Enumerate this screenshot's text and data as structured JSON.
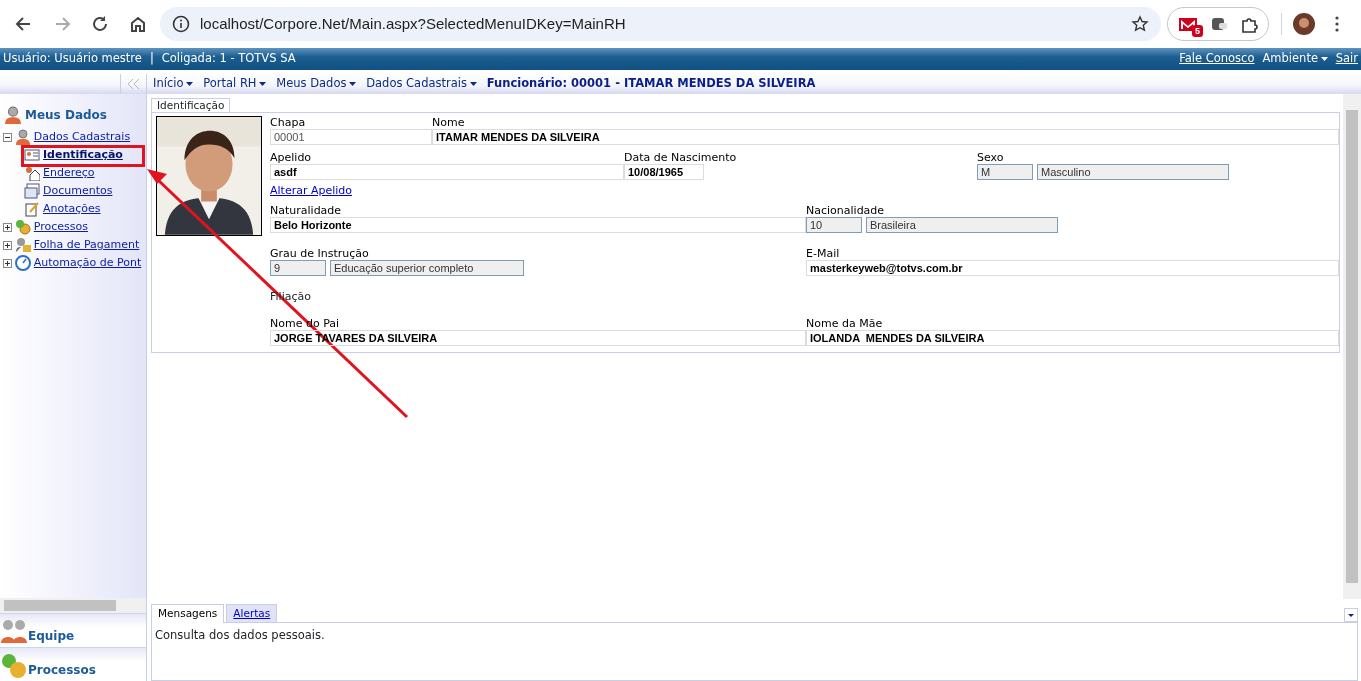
{
  "browser": {
    "url": "localhost/Corpore.Net/Main.aspx?SelectedMenuIDKey=MainRH",
    "extension_badge": "5"
  },
  "topbar": {
    "user": "Usuário: Usuário mestre",
    "separator": "|",
    "company": "Coligada: 1 - TOTVS SA",
    "links": [
      {
        "label": "Fale Conosco",
        "kind": "link"
      },
      {
        "label": "Ambiente",
        "kind": "menu"
      },
      {
        "label": "Sair",
        "kind": "link"
      }
    ]
  },
  "breadcrumb": {
    "items": [
      "Início",
      "Portal RH",
      "Meus Dados",
      "Dados Cadastrais"
    ],
    "current": "Funcionário: 00001 - ITAMAR MENDES DA SILVEIRA"
  },
  "sidebar": {
    "title": "Meus Dados",
    "tree": [
      {
        "label": "Dados Cadastrais",
        "expanded": true,
        "children": [
          {
            "label": "Identificação",
            "selected": true
          },
          {
            "label": "Endereço",
            "selected": false
          },
          {
            "label": "Documentos",
            "selected": false
          },
          {
            "label": "Anotações",
            "selected": false
          }
        ]
      },
      {
        "label": "Processos",
        "expanded": false
      },
      {
        "label": "Folha de Pagament",
        "expanded": false
      },
      {
        "label": "Automação de Pont",
        "expanded": false
      }
    ],
    "sections": [
      "Equipe",
      "Processos"
    ]
  },
  "content": {
    "tabs": [
      {
        "label": "Identificação",
        "selected": true
      }
    ],
    "form": [
      {
        "kind": "fields",
        "fields": [
          {
            "label": "Chapa",
            "kind": "muted",
            "value": "00001"
          },
          {
            "label": "Nome",
            "kind": "text",
            "value": "ITAMAR MENDES DA SILVEIRA"
          }
        ]
      },
      {
        "kind": "fields",
        "fields": [
          {
            "label": "Apelido",
            "kind": "text",
            "value": "asdf"
          },
          {
            "label": "Data de Nascimento",
            "kind": "text",
            "value": "10/08/1965"
          },
          {
            "label": "Sexo",
            "kind": "lookup",
            "code": "M",
            "value": "Masculino"
          }
        ]
      },
      {
        "kind": "link",
        "label": "Alterar Apelido"
      },
      {
        "kind": "fields",
        "fields": [
          {
            "label": "Naturalidade",
            "kind": "text",
            "value": "Belo Horizonte"
          },
          {
            "label": "Nacionalidade",
            "kind": "lookup",
            "code": "10",
            "value": "Brasileira"
          }
        ]
      },
      {
        "kind": "fields",
        "fields": [
          {
            "label": "Grau de Instrução",
            "kind": "lookup",
            "code": "9",
            "value": "Educação superior completo"
          },
          {
            "label": "E-Mail",
            "kind": "text",
            "value": "masterkeyweb@totvs.com.br"
          }
        ]
      },
      {
        "kind": "heading",
        "label": "Filiação"
      },
      {
        "kind": "fields",
        "fields": [
          {
            "label": "Nome do Pai",
            "kind": "text",
            "value": "JORGE TAVARES DA SILVEIRA"
          },
          {
            "label": "Nome da Mãe",
            "kind": "text",
            "value": "IOLANDA  MENDES DA SILVEIRA"
          }
        ]
      }
    ]
  },
  "messages": {
    "tabs": [
      {
        "label": "Mensagens",
        "selected": true
      },
      {
        "label": "Alertas",
        "selected": false
      }
    ],
    "text": "Consulta dos dados pessoais."
  }
}
